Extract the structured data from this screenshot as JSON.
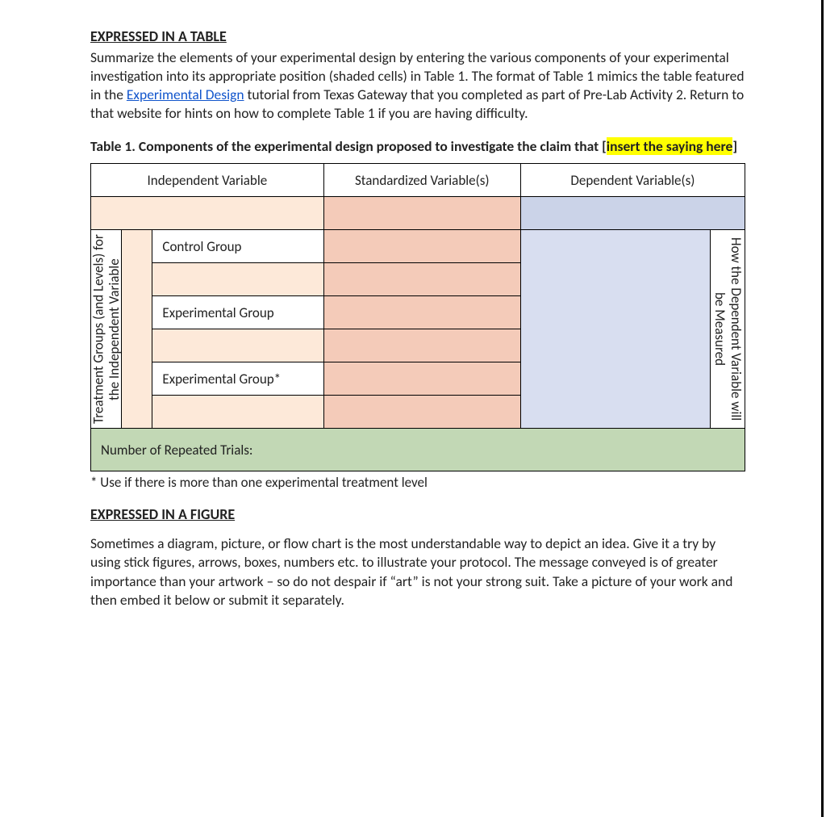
{
  "section1_title": "EXPRESSED IN A TABLE",
  "intro_pre": "Summarize the elements of your experimental design by entering the various components of your experimental investigation into its appropriate position (shaded cells) in Table 1.  The format of Table 1 mimics the table featured in the ",
  "intro_link": "Experimental Design",
  "intro_post": " tutorial from Texas Gateway that you completed as part of Pre-Lab Activity 2.  Return to that website for hints on how to complete Table 1 if you are having difficulty.",
  "caption_lead": "Table 1.  Components of the experimental design proposed to investigate the claim that [",
  "caption_hl": "insert the saying here",
  "caption_end": "]",
  "headers": {
    "iv": "Independent Variable",
    "sv": "Standardized Variable(s)",
    "dv": "Dependent Variable(s)"
  },
  "rowlabel_outer": "Treatment Groups (and Levels) for the Independent Variable",
  "rows": {
    "control": "Control Group",
    "exp1": "Experimental Group",
    "exp2": "Experimental Group*"
  },
  "rowlabel_right": "How the Dependent Variable will be Measured",
  "repeated": "Number of Repeated Trials:",
  "footnote": "* Use if there is more than one experimental treatment level",
  "section2_title": "EXPRESSED IN A FIGURE",
  "figure_para": "Sometimes a diagram, picture, or flow chart is the most understandable way to depict an idea.  Give it a try by using stick figures, arrows, boxes, numbers etc. to illustrate your protocol.  The message conveyed is of greater importance than your artwork – so do not despair if “art” is not your strong suit.  Take a picture of your work and then embed it below or submit it separately."
}
